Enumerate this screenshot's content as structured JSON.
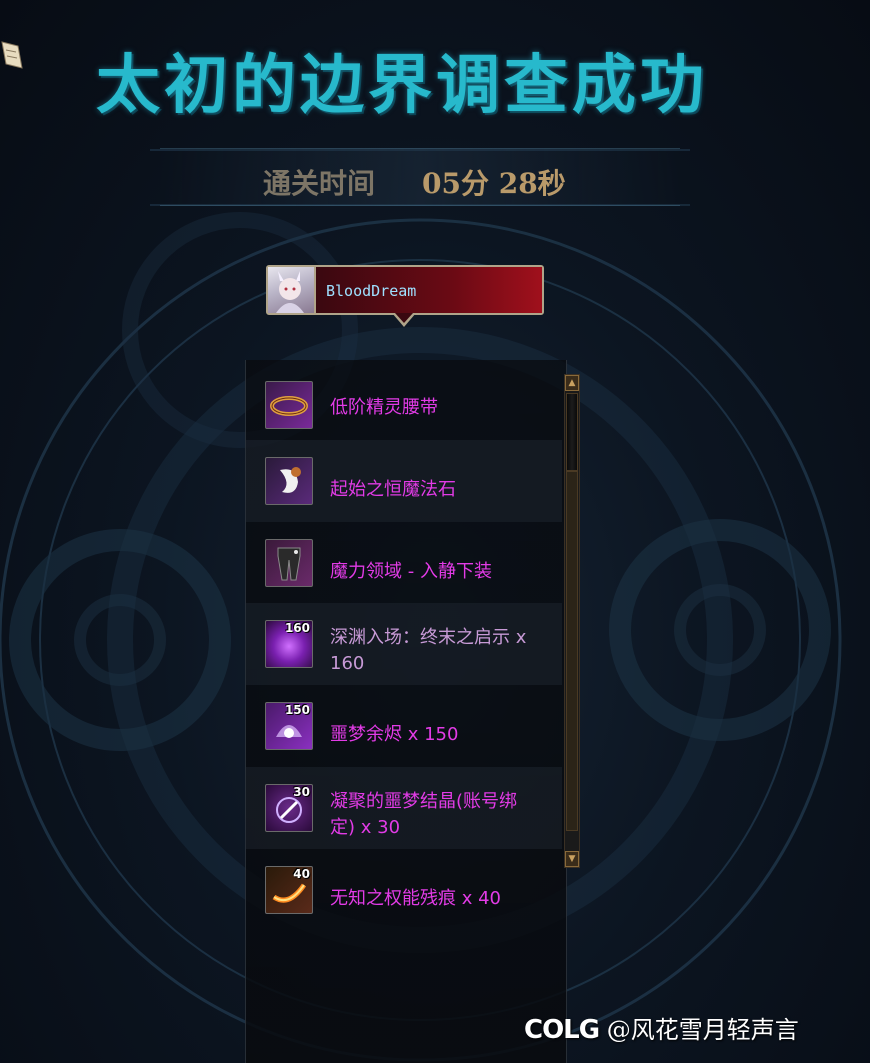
{
  "title": "太初的边界调查成功",
  "clear_time": {
    "label": "通关时间",
    "value": "05分 28秒"
  },
  "player": {
    "name": "BloodDream"
  },
  "items": [
    {
      "name": "低阶精灵腰带",
      "count": "",
      "color": "#e23be6"
    },
    {
      "name": "起始之恒魔法石",
      "count": "",
      "color": "#e23be6"
    },
    {
      "name": "魔力领域 - 入静下装",
      "count": "",
      "color": "#e23be6"
    },
    {
      "name": "深渊入场：终末之启示 x 160",
      "count": "160",
      "color": "#c79ad6"
    },
    {
      "name": "噩梦余烬 x 150",
      "count": "150",
      "color": "#e23be6"
    },
    {
      "name": "凝聚的噩梦结晶(账号绑定) x 30",
      "count": "30",
      "color": "#e23be6"
    },
    {
      "name": "无知之权能残痕 x 40",
      "count": "40",
      "color": "#e23be6"
    }
  ],
  "watermark": {
    "logo": "COLG",
    "handle": "@风花雪月轻声言"
  },
  "colors": {
    "title": "#27b9cc",
    "item_epic": "#e23be6",
    "player_name": "#9ee0ff"
  }
}
